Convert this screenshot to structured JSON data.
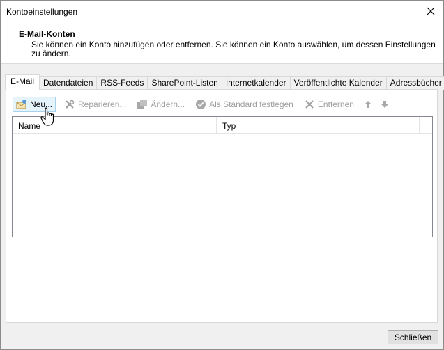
{
  "window": {
    "title": "Kontoeinstellungen"
  },
  "header": {
    "title": "E-Mail-Konten",
    "description": "Sie können ein Konto hinzufügen oder entfernen. Sie können ein Konto auswählen, um dessen Einstellungen zu ändern."
  },
  "tabs": [
    {
      "label": "E-Mail",
      "active": true
    },
    {
      "label": "Datendateien"
    },
    {
      "label": "RSS-Feeds"
    },
    {
      "label": "SharePoint-Listen"
    },
    {
      "label": "Internetkalender"
    },
    {
      "label": "Veröffentlichte Kalender"
    },
    {
      "label": "Adressbücher"
    }
  ],
  "toolbar": {
    "new_label": "Neu...",
    "repair_label": "Reparieren...",
    "change_label": "Ändern...",
    "default_label": "Als Standard festlegen",
    "remove_label": "Entfernen"
  },
  "list": {
    "columns": [
      "Name",
      "Typ"
    ],
    "rows": []
  },
  "footer": {
    "close_label": "Schließen"
  },
  "colors": {
    "accent_hover": "#e5f3fb",
    "disabled_text": "#a0a0a0"
  }
}
